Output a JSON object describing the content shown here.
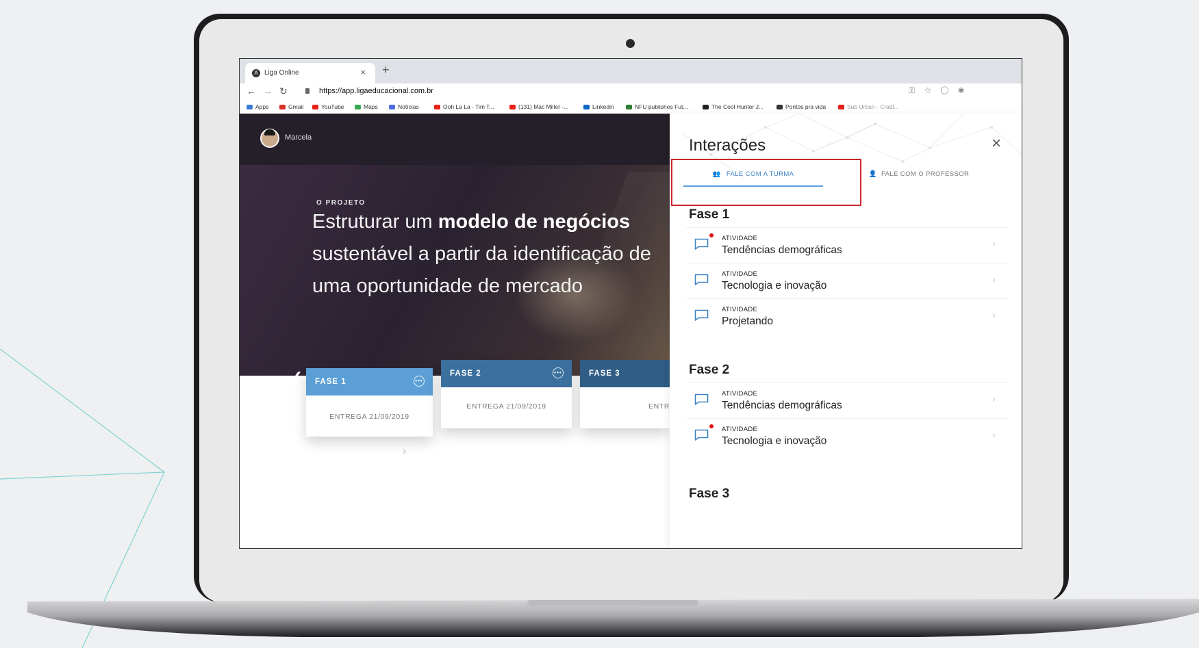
{
  "browser": {
    "tab_title": "Liga Online",
    "tab_close": "×",
    "new_tab": "+",
    "url": "https://app.ligaeducacional.com.br",
    "bookmarks": [
      {
        "label": "Apps",
        "color": "#3a7bd5"
      },
      {
        "label": "Gmail",
        "color": "#d93025"
      },
      {
        "label": "YouTube",
        "color": "#e62117"
      },
      {
        "label": "Maps",
        "color": "#34a853"
      },
      {
        "label": "Notícias",
        "color": "#4a6ee0"
      },
      {
        "label": "Ooh La La - Tim T...",
        "color": "#e62117"
      },
      {
        "label": "(131) Mac Miller -...",
        "color": "#e62117"
      },
      {
        "label": "Linkedin",
        "color": "#0a66c2"
      },
      {
        "label": "NFU publishes Fut...",
        "color": "#2e7d32"
      },
      {
        "label": "The Cool Hunter J...",
        "color": "#222222"
      },
      {
        "label": "Pontos pra vida",
        "color": "#333333"
      },
      {
        "label": "Sub Urban - Cradl...",
        "color": "#e62117"
      }
    ]
  },
  "user": {
    "name": "Marcela"
  },
  "hero": {
    "kicker": "O PROJETO",
    "headline_pre": "Estruturar um ",
    "headline_bold": "modelo de negócios",
    "headline_post": "sustentável a partir da identificação de uma oportunidade de mercado"
  },
  "phases_cards": [
    {
      "label": "FASE 1",
      "delivery": "ENTREGA 21/09/2019",
      "color": "#5b9fd6"
    },
    {
      "label": "FASE 2",
      "delivery": "ENTREGA 21/09/2019",
      "color": "#3a6f9e"
    },
    {
      "label": "FASE 3",
      "delivery": "ENTR",
      "color": "#2f5d85"
    }
  ],
  "panel": {
    "title": "Interações",
    "close_icon": "×",
    "tabs": [
      {
        "label": "FALE COM A TURMA",
        "icon": "users-icon",
        "active": true
      },
      {
        "label": "FALE COM O PROFESSOR",
        "icon": "user-icon",
        "active": false
      }
    ],
    "groups": [
      {
        "title": "Fase 1",
        "items": [
          {
            "kind": "ATIVIDADE",
            "name": "Tendências demográficas",
            "unread": true
          },
          {
            "kind": "ATIVIDADE",
            "name": "Tecnologia e inovação",
            "unread": false
          },
          {
            "kind": "ATIVIDADE",
            "name": "Projetando",
            "unread": false
          }
        ]
      },
      {
        "title": "Fase 2",
        "items": [
          {
            "kind": "ATIVIDADE",
            "name": "Tendências demográficas",
            "unread": false
          },
          {
            "kind": "ATIVIDADE",
            "name": "Tecnologia e inovação",
            "unread": true
          }
        ]
      },
      {
        "title": "Fase 3",
        "items": []
      }
    ],
    "highlight_color": "#c9282d",
    "accent_color": "#3e82c4"
  }
}
